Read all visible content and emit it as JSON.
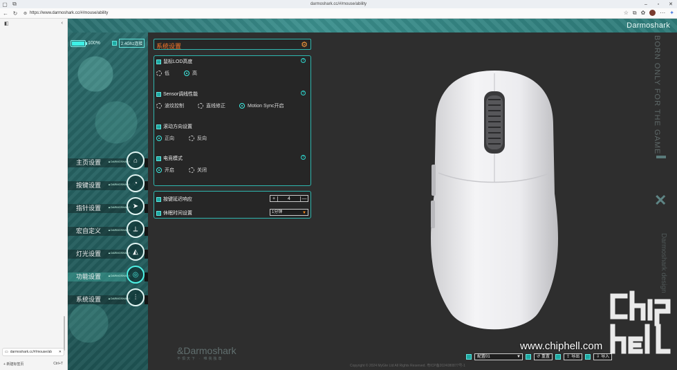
{
  "browser": {
    "title": "darmoshark.cc/#/mouse/ability",
    "url": "https://www.darmoshark.cc/#/mouse/ability",
    "window_controls": [
      "–",
      "▫",
      "✕"
    ]
  },
  "vertical_tabs": {
    "active_tab": "darmoshark.cc/#/mouse/ab",
    "new_tab_label": "新建标签页",
    "new_tab_shortcut": "Ctrl+T"
  },
  "app": {
    "brand": "Darmoshark",
    "battery_percent_label": "100%",
    "battery_level": 1.0,
    "connection": "2.4Ghz连接",
    "nav": [
      {
        "label": "主页设置",
        "tag": "▲DARMOSHARK",
        "icon": "⌂"
      },
      {
        "label": "按键设置",
        "tag": "▲DARMOSHARK",
        "icon": "◔"
      },
      {
        "label": "指针设置",
        "tag": "▲DARMOSHARK",
        "icon": "➤"
      },
      {
        "label": "宏自定义",
        "tag": "▲DARMOSHARK",
        "icon": "⟂"
      },
      {
        "label": "灯光设置",
        "tag": "▲DARMOSHARK",
        "icon": "◭"
      },
      {
        "label": "功能设置",
        "tag": "▲DARMOSHARK",
        "icon": "◎"
      },
      {
        "label": "系统设置",
        "tag": "▲DARMOSHARK",
        "icon": "⫶"
      }
    ],
    "active_nav": "功能设置",
    "panel": {
      "title": "系统设置",
      "lod": {
        "label": "鼠标LOD高度",
        "options": [
          "低",
          "高"
        ],
        "selected": "高"
      },
      "sensor": {
        "label": "Sensor调线性能",
        "options": [
          "波纹控制",
          "直线修正",
          "Motion Sync开启"
        ],
        "selected": "Motion Sync开启"
      },
      "scroll": {
        "label": "滚动方向设置",
        "options": [
          "正向",
          "反向"
        ],
        "selected": "正向"
      },
      "esports": {
        "label": "电竞模式",
        "options": [
          "开启",
          "关闭"
        ],
        "selected": "开启"
      },
      "debounce": {
        "label": "按键延迟响应",
        "value": "4"
      },
      "sleep": {
        "label": "休眠时间设置",
        "value": "1分钟"
      }
    },
    "side_text": "BORN ONLY FOR THE GAME",
    "side_text2": "Darmoshark design",
    "bottom_logo": "&Darmoshark",
    "bottom_logo_sub": "不惧天下 · 唯我独尊",
    "toolbar": {
      "config": "配置01",
      "reset": "重置",
      "export": "导出",
      "import": "导入"
    },
    "copyright": "Copyright © 2024 MyGte Ltd All Rights Reserved. 粤ICP备2024080877号-1"
  },
  "watermark": {
    "site": "www.chiphell.com",
    "logo_text": "chip hell"
  },
  "colors": {
    "accent": "#2fb8b0",
    "title_orange": "#ff7a2a",
    "app_bg": "#2e2e2e"
  }
}
